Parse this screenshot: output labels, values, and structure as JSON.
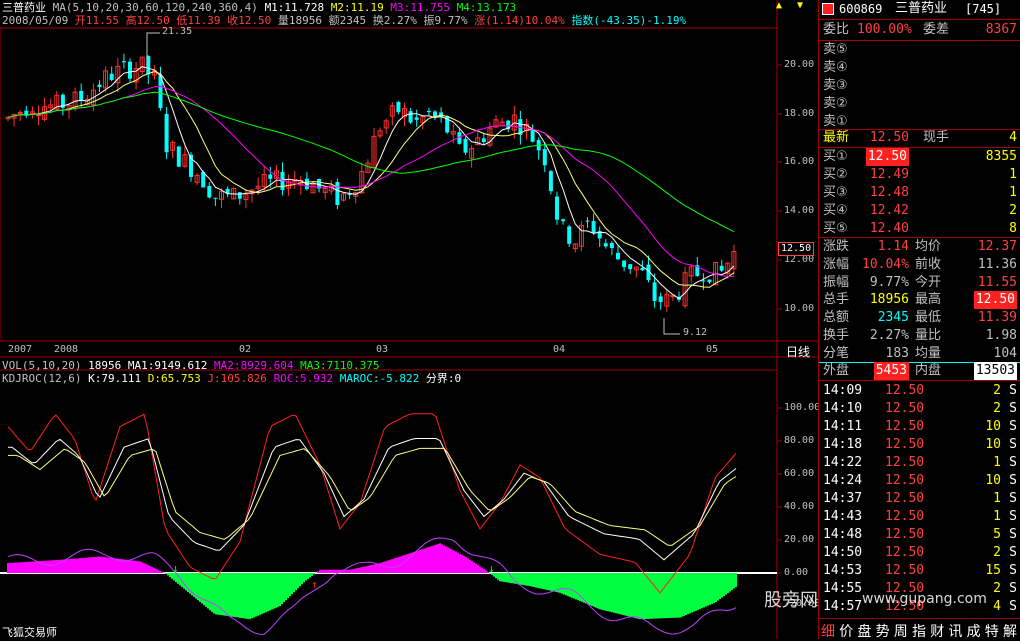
{
  "chart_header": {
    "stock_name": "三普药业",
    "ma_label": "MA(5,10,20,30,60,120,240,360,4)",
    "m1": "M1:11.728",
    "m2": "M2:11.19",
    "m3": "M3:11.755",
    "m4": "M4:13.173",
    "date": "2008/05/09",
    "open": "开11.55",
    "high": "高12.50",
    "low": "低11.39",
    "close": "收12.50",
    "volume": "量18956",
    "amount": "额2345",
    "turnover": "换2.27%",
    "amplitude": "振9.77%",
    "change": "涨(1.14)10.04%",
    "index": "指数(-43.35)-1.19%"
  },
  "price_axis": [
    "20.00",
    "18.00",
    "16.00",
    "14.00",
    "12.00",
    "10.00"
  ],
  "current_price_tag": "12.50",
  "high_marker": "21.35",
  "low_marker": "9.12",
  "x_axis": [
    "2007",
    "2008",
    "02",
    "03",
    "04",
    "05"
  ],
  "period_label": "日线",
  "vol_header": {
    "label": "VOL(5,10,20)",
    "value": "18956",
    "ma1": "MA1:9149.612",
    "ma2": "MA2:8929.604",
    "ma3": "MA3:7110.375"
  },
  "kdj_header": {
    "label": "KDJROC(12,6)",
    "k": "K:79.111",
    "d": "D:65.753",
    "j": "J:105.826",
    "roc": "ROC:5.932",
    "maroc": "MAROC:-5.822",
    "divider": "分界:0"
  },
  "ind_axis": [
    "100.00",
    "80.00",
    "60.00",
    "40.00",
    "20.00",
    "0.00",
    "-20.00"
  ],
  "bottom_left": "飞狐交易师",
  "watermark_cn": "股旁网",
  "watermark_url": "www.gupang.com",
  "panel": {
    "code": "600869",
    "name": "三普药业",
    "num": "[745]",
    "weibi_label": "委比",
    "weibi_value": "100.00%",
    "weicha_label": "委差",
    "weicha_value": "8367",
    "sell": [
      "卖⑤",
      "卖④",
      "卖③",
      "卖②",
      "卖①"
    ],
    "latest_label": "最新",
    "latest_value": "12.50",
    "xianshou_label": "现手",
    "xianshou_value": "4",
    "buy": [
      {
        "label": "买①",
        "price": "12.50",
        "vol": "8355"
      },
      {
        "label": "买②",
        "price": "12.49",
        "vol": "1"
      },
      {
        "label": "买③",
        "price": "12.48",
        "vol": "1"
      },
      {
        "label": "买④",
        "price": "12.42",
        "vol": "2"
      },
      {
        "label": "买⑤",
        "price": "12.40",
        "vol": "8"
      }
    ],
    "stats": [
      {
        "l1": "涨跌",
        "v1": "1.14",
        "l2": "均价",
        "v2": "12.37"
      },
      {
        "l1": "涨幅",
        "v1": "10.04%",
        "l2": "前收",
        "v2": "11.36"
      },
      {
        "l1": "振幅",
        "v1": "9.77%",
        "l2": "今开",
        "v2": "11.55"
      },
      {
        "l1": "总手",
        "v1": "18956",
        "l2": "最高",
        "v2": "12.50"
      },
      {
        "l1": "总额",
        "v1": "2345",
        "l2": "最低",
        "v2": "11.39"
      },
      {
        "l1": "换手",
        "v1": "2.27%",
        "l2": "量比",
        "v2": "1.98"
      },
      {
        "l1": "分笔",
        "v1": "183",
        "l2": "均量",
        "v2": "104"
      }
    ],
    "waipan_label": "外盘",
    "waipan_value": "5453",
    "neipan_label": "内盘",
    "neipan_value": "13503",
    "ticks": [
      {
        "t": "14:09",
        "p": "12.50",
        "v": "2",
        "s": "S"
      },
      {
        "t": "14:10",
        "p": "12.50",
        "v": "2",
        "s": "S"
      },
      {
        "t": "14:11",
        "p": "12.50",
        "v": "10",
        "s": "S"
      },
      {
        "t": "14:18",
        "p": "12.50",
        "v": "10",
        "s": "S"
      },
      {
        "t": "14:22",
        "p": "12.50",
        "v": "1",
        "s": "S"
      },
      {
        "t": "14:24",
        "p": "12.50",
        "v": "10",
        "s": "S"
      },
      {
        "t": "14:37",
        "p": "12.50",
        "v": "1",
        "s": "S"
      },
      {
        "t": "14:43",
        "p": "12.50",
        "v": "1",
        "s": "S"
      },
      {
        "t": "14:48",
        "p": "12.50",
        "v": "5",
        "s": "S"
      },
      {
        "t": "14:50",
        "p": "12.50",
        "v": "2",
        "s": "S"
      },
      {
        "t": "14:53",
        "p": "12.50",
        "v": "15",
        "s": "S"
      },
      {
        "t": "14:55",
        "p": "12.50",
        "v": "2",
        "s": "S"
      },
      {
        "t": "14:57",
        "p": "12.50",
        "v": "4",
        "s": "S"
      }
    ],
    "tabs": [
      "细",
      "价",
      "盘",
      "势",
      "周",
      "指",
      "财",
      "讯",
      "成",
      "特",
      "解"
    ]
  }
}
